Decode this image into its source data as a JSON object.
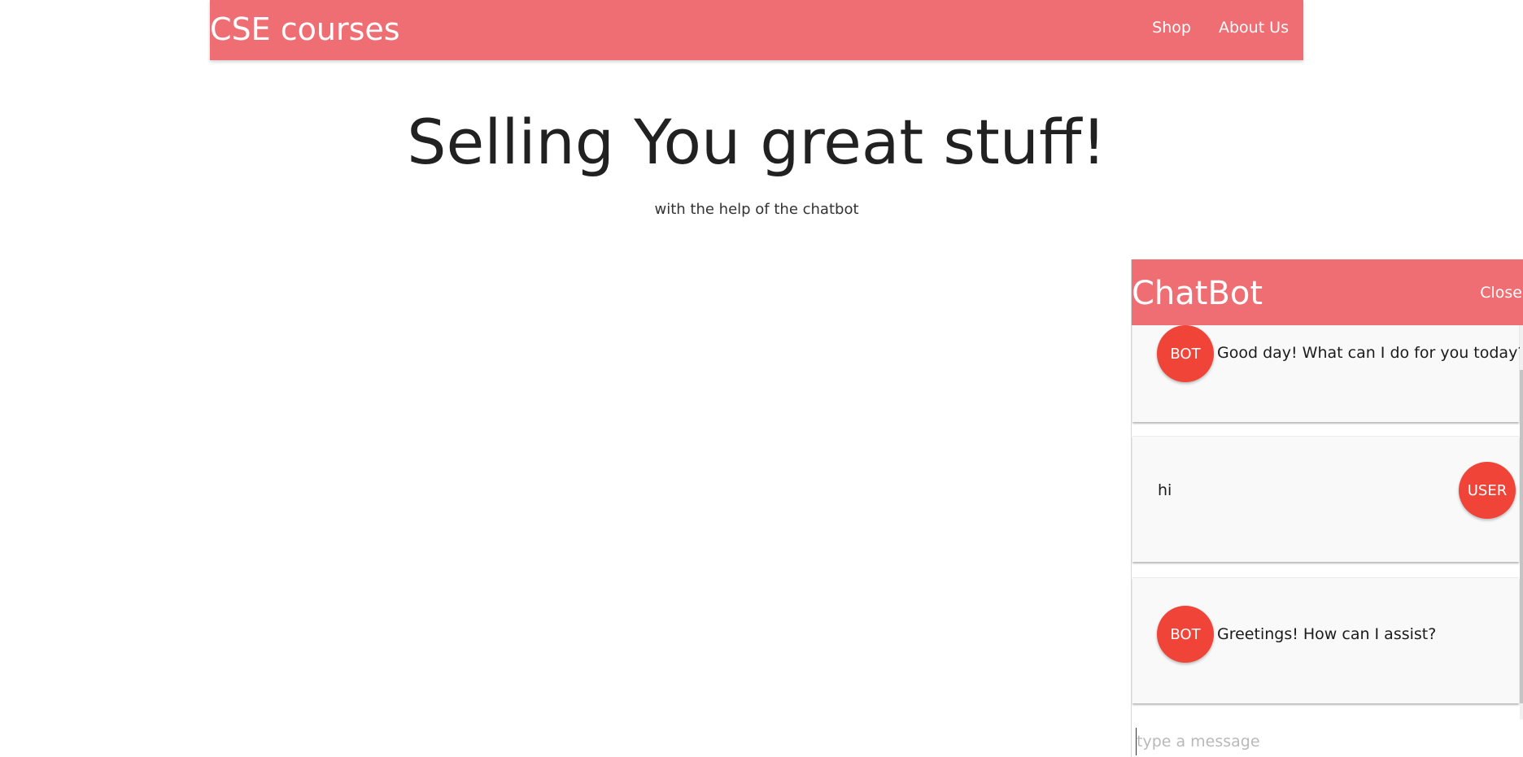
{
  "header": {
    "brand": "CSE courses",
    "nav": [
      {
        "label": "Shop"
      },
      {
        "label": "About Us"
      }
    ],
    "color": "#ef6e73"
  },
  "hero": {
    "title": "Selling You great stuff!",
    "subtitle": "with the help of the chatbot"
  },
  "chat": {
    "title": "ChatBot",
    "close_label": "Close",
    "messages": [
      {
        "sender": "BOT",
        "text": "Good day! What can I do for you today?"
      },
      {
        "sender": "USER",
        "text": "hi"
      },
      {
        "sender": "BOT",
        "text": "Greetings! How can I assist?"
      }
    ],
    "input": {
      "placeholder": "type a message",
      "value": ""
    },
    "avatar_color": "#f04438"
  }
}
